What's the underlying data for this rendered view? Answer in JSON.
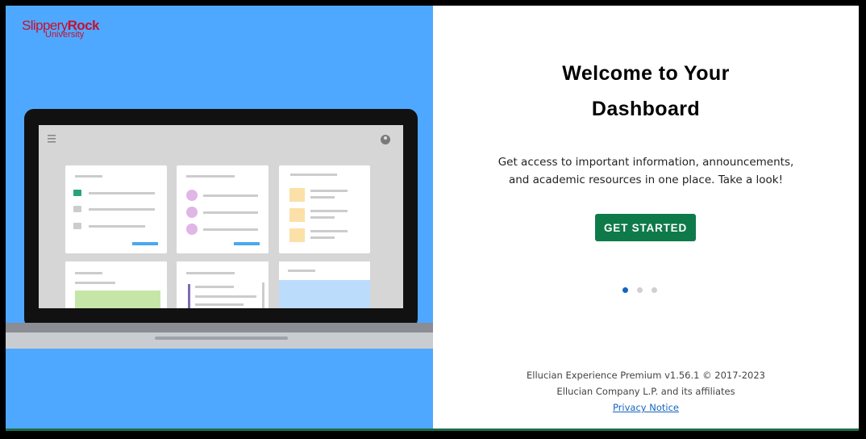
{
  "branding": {
    "logo_line1_a": "Slippery",
    "logo_line1_b": "Rock",
    "logo_line2": "University",
    "brand_color": "#c8102e"
  },
  "hero": {
    "background_color": "#4fa8ff",
    "illustration": "laptop-dashboard-illustration"
  },
  "welcome": {
    "title_line1": "Welcome to Your",
    "title_line2": "Dashboard",
    "description_line1": "Get access to important information, announcements,",
    "description_line2": "and academic resources in one place. Take a look!",
    "button_label": "GET STARTED",
    "button_color": "#0e7a4a"
  },
  "pager": {
    "count": 3,
    "active_index": 0
  },
  "footer": {
    "line1": "Ellucian Experience Premium v1.56.1 © 2017-2023",
    "line2": "Ellucian Company L.P. and its affiliates",
    "privacy_link": "Privacy Notice"
  }
}
